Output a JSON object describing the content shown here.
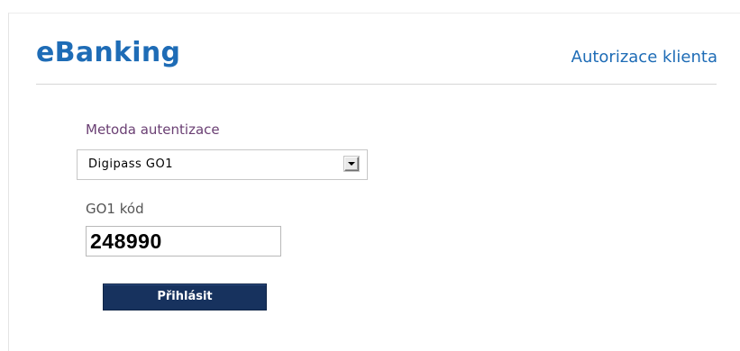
{
  "header": {
    "brand": "eBanking",
    "page_title": "Autorizace klienta"
  },
  "form": {
    "method_label": "Metoda autentizace",
    "method_value": "Digipass GO1",
    "code_label": "GO1 kód",
    "code_value": "248990",
    "submit_label": "Přihlásit"
  },
  "colors": {
    "brand_blue": "#1e6cb6",
    "button_navy": "#17325e",
    "method_label": "#6a3f73"
  }
}
